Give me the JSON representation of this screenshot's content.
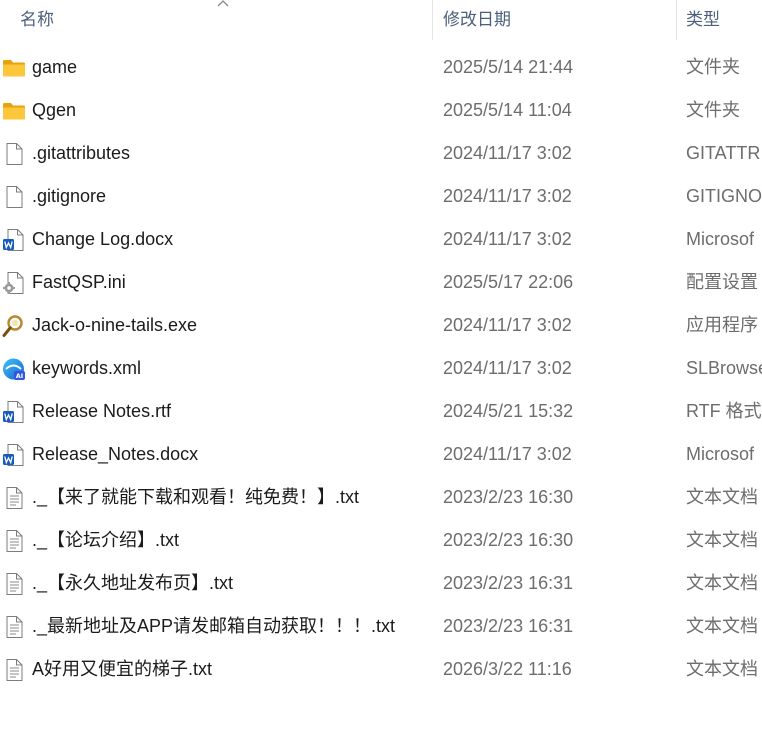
{
  "header": {
    "name_label": "名称",
    "date_label": "修改日期",
    "type_label": "类型",
    "sort_icon": "chevron-up-icon"
  },
  "files": [
    {
      "name": "game",
      "date": "2025/5/14 21:44",
      "type": "文件夹",
      "icon": "folder-icon"
    },
    {
      "name": "Qgen",
      "date": "2025/5/14 11:04",
      "type": "文件夹",
      "icon": "folder-icon"
    },
    {
      "name": ".gitattributes",
      "date": "2024/11/17 3:02",
      "type": "GITATTRI",
      "icon": "blank-file-icon"
    },
    {
      "name": ".gitignore",
      "date": "2024/11/17 3:02",
      "type": "GITIGNO",
      "icon": "blank-file-icon"
    },
    {
      "name": "Change Log.docx",
      "date": "2024/11/17 3:02",
      "type": "Microsof",
      "icon": "word-document-icon"
    },
    {
      "name": "FastQSP.ini",
      "date": "2025/5/17 22:06",
      "type": "配置设置",
      "icon": "settings-file-icon"
    },
    {
      "name": "Jack-o-nine-tails.exe",
      "date": "2024/11/17 3:02",
      "type": "应用程序",
      "icon": "application-icon"
    },
    {
      "name": "keywords.xml",
      "date": "2024/11/17 3:02",
      "type": "SLBrowse",
      "icon": "browser-file-icon"
    },
    {
      "name": "Release Notes.rtf",
      "date": "2024/5/21 15:32",
      "type": "RTF 格式",
      "icon": "word-document-icon"
    },
    {
      "name": "Release_Notes.docx",
      "date": "2024/11/17 3:02",
      "type": "Microsof",
      "icon": "word-document-icon"
    },
    {
      "name": "._【来了就能下载和观看！纯免费！】.txt",
      "date": "2023/2/23 16:30",
      "type": "文本文档",
      "icon": "text-file-icon"
    },
    {
      "name": "._【论坛介绍】.txt",
      "date": "2023/2/23 16:30",
      "type": "文本文档",
      "icon": "text-file-icon"
    },
    {
      "name": "._【永久地址发布页】.txt",
      "date": "2023/2/23 16:31",
      "type": "文本文档",
      "icon": "text-file-icon"
    },
    {
      "name": "._最新地址及APP请发邮箱自动获取！！！.txt",
      "date": "2023/2/23 16:31",
      "type": "文本文档",
      "icon": "text-file-icon"
    },
    {
      "name": "A好用又便宜的梯子.txt",
      "date": "2026/3/22 11:16",
      "type": "文本文档",
      "icon": "text-file-icon"
    }
  ]
}
